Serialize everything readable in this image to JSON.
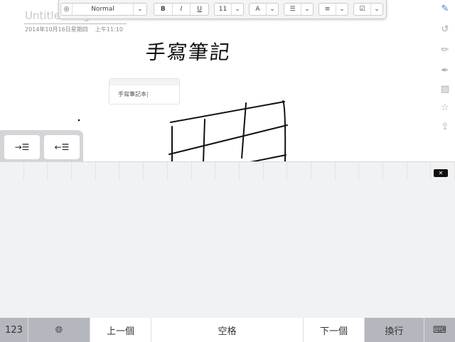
{
  "page": {
    "title": "Untitled Page",
    "date": "2014年10月16日星期四",
    "time": "上午11:10"
  },
  "toolbar": {
    "style": "Normal",
    "bold": "B",
    "italic": "I",
    "underline": "U",
    "font_size": "11",
    "font_color": "A",
    "chevron": "⌄"
  },
  "handwriting": "手寫筆記",
  "textbox": {
    "text": "手寫筆記本"
  },
  "indent": {
    "increase": "→☰",
    "decrease": "←☰"
  },
  "keyboard": {
    "numbers": "123",
    "prev": "上一個",
    "space": "空格",
    "next": "下一個",
    "return": "換行",
    "backspace": "✕"
  },
  "colors": {
    "accent": "#4a7fd6",
    "dark_key": "#b4b7bd"
  }
}
